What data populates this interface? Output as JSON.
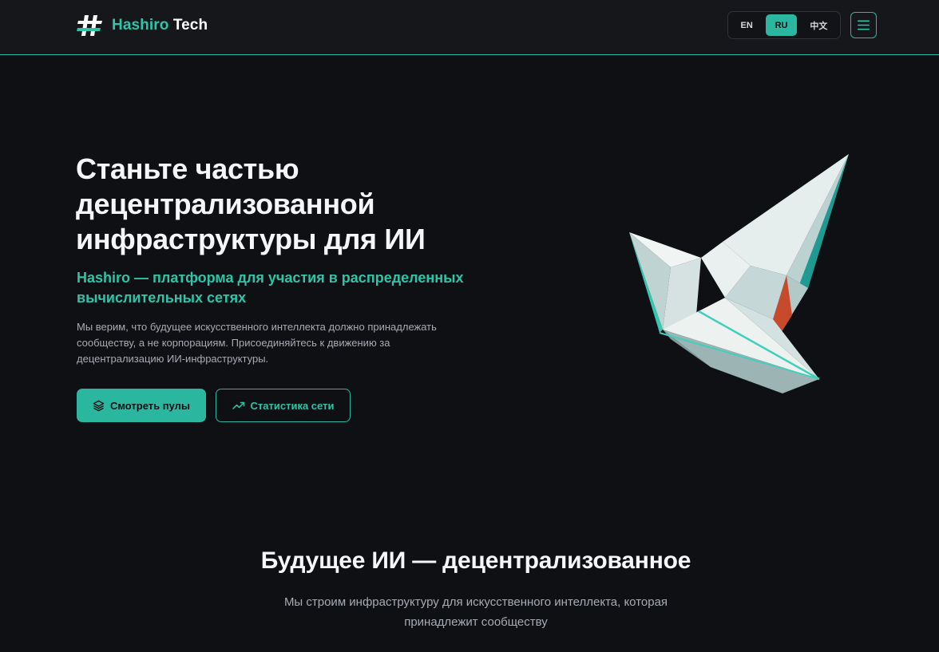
{
  "header": {
    "brand_accent": "Hashiro",
    "brand_plain": "Tech",
    "languages": [
      {
        "label": "EN",
        "active": false
      },
      {
        "label": "RU",
        "active": true
      },
      {
        "label": "中文",
        "active": false
      }
    ],
    "menu_icon": "hamburger-menu-icon"
  },
  "hero": {
    "title": "Станьте частью децентрализованной инфраструктуры для ИИ",
    "subtitle": "Hashiro — платформа для участия в распределенных вычислительных сетях",
    "description": "Мы верим, что будущее искусственного интеллекта должно принадлежать сообществу, а не корпорациям. Присоединяйтесь к движению за децентрализацию ИИ-инфраструктуры.",
    "primary_button": {
      "label": "Смотреть пулы",
      "icon": "layers-icon"
    },
    "secondary_button": {
      "label": "Статистика сети",
      "icon": "trending-up-icon"
    },
    "illustration": "origami-crane-image"
  },
  "section": {
    "title": "Будущее ИИ — децентрализованное",
    "description": "Мы строим инфраструктуру для искусственного интеллекта, которая принадлежит сообществу"
  },
  "colors": {
    "accent": "#2bb6a0",
    "background": "#0f1013",
    "header_background": "#16171a"
  }
}
